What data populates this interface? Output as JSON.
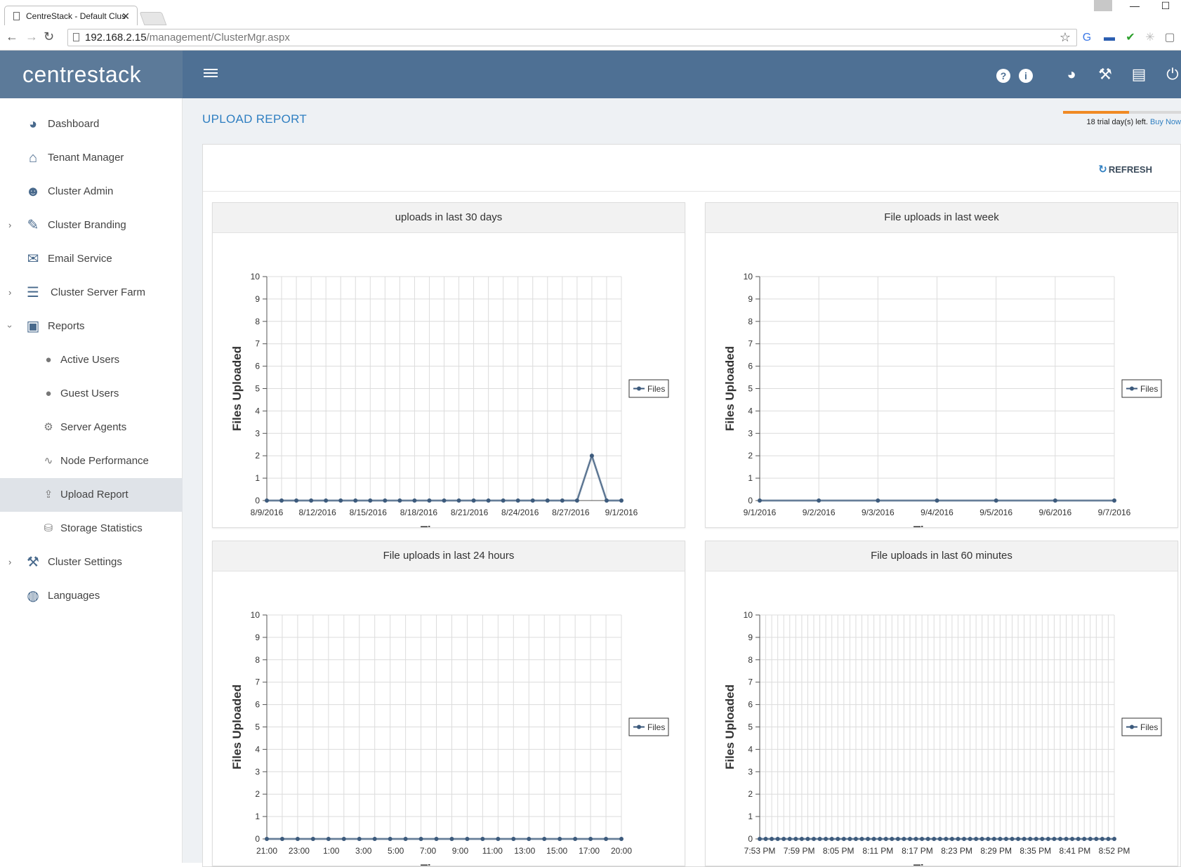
{
  "browser": {
    "tab_title": "CentreStack - Default Clus",
    "url_host": "192.168.2.15",
    "url_path": "/management/ClusterMgr.aspx"
  },
  "brand": {
    "name": "centrestack"
  },
  "colors": {
    "header": "#4e7094",
    "brand_bg": "#5c7a99",
    "accent": "#2f7fc1",
    "trial_bar": "#f08a24",
    "series": "#3c5a7c"
  },
  "sidebar": {
    "items": [
      {
        "label": "Dashboard",
        "icon": "dashboard-icon"
      },
      {
        "label": "Tenant Manager",
        "icon": "tenant-icon"
      },
      {
        "label": "Cluster Admin",
        "icon": "admin-icon"
      },
      {
        "label": "Cluster Branding",
        "icon": "branding-icon",
        "expandable": true
      },
      {
        "label": "Email Service",
        "icon": "email-icon"
      },
      {
        "label": "Cluster Server Farm",
        "icon": "server-farm-icon",
        "expandable": true
      },
      {
        "label": "Reports",
        "icon": "reports-icon",
        "expanded": true
      },
      {
        "label": "Active Users",
        "icon": "user-icon",
        "sub": true
      },
      {
        "label": "Guest Users",
        "icon": "guest-icon",
        "sub": true
      },
      {
        "label": "Server Agents",
        "icon": "agent-icon",
        "sub": true
      },
      {
        "label": "Node Performance",
        "icon": "performance-icon",
        "sub": true
      },
      {
        "label": "Upload Report",
        "icon": "upload-icon",
        "sub": true,
        "active": true
      },
      {
        "label": "Storage Statistics",
        "icon": "storage-icon",
        "sub": true
      },
      {
        "label": "Cluster Settings",
        "icon": "settings-icon",
        "expandable": true
      },
      {
        "label": "Languages",
        "icon": "globe-icon"
      }
    ]
  },
  "main": {
    "title": "UPLOAD REPORT",
    "trial_text": "18 trial day(s) left.",
    "trial_link": "Buy Now",
    "trial_progress": 0.56,
    "refresh_label": "REFRESH"
  },
  "chart_data": [
    {
      "type": "line",
      "title": "uploads in last 30 days",
      "xlabel": "Time",
      "ylabel": "Files Uploaded",
      "ylim": [
        0,
        10
      ],
      "grid": true,
      "legend": "right",
      "x_tick_labels": [
        "8/9/2016",
        "8/12/2016",
        "8/15/2016",
        "8/18/2016",
        "8/21/2016",
        "8/24/2016",
        "8/27/2016",
        "9/1/2016"
      ],
      "series": [
        {
          "name": "Files",
          "values": [
            0,
            0,
            0,
            0,
            0,
            0,
            0,
            0,
            0,
            0,
            0,
            0,
            0,
            0,
            0,
            0,
            0,
            0,
            0,
            0,
            0,
            0,
            2,
            0,
            0
          ]
        }
      ]
    },
    {
      "type": "line",
      "title": "File uploads in last week",
      "xlabel": "Time",
      "ylabel": "Files Uploaded",
      "ylim": [
        0,
        10
      ],
      "grid": true,
      "legend": "right",
      "x_tick_labels": [
        "9/1/2016",
        "9/2/2016",
        "9/3/2016",
        "9/4/2016",
        "9/5/2016",
        "9/6/2016",
        "9/7/2016"
      ],
      "series": [
        {
          "name": "Files",
          "values": [
            0,
            0,
            0,
            0,
            0,
            0,
            0
          ]
        }
      ]
    },
    {
      "type": "line",
      "title": "File uploads in last 24 hours",
      "xlabel": "Time",
      "ylabel": "Files Uploaded",
      "ylim": [
        0,
        10
      ],
      "grid": true,
      "legend": "right",
      "x_tick_labels": [
        "21:00",
        "23:00",
        "1:00",
        "3:00",
        "5:00",
        "7:00",
        "9:00",
        "11:00",
        "13:00",
        "15:00",
        "17:00",
        "20:00"
      ],
      "series": [
        {
          "name": "Files",
          "values": [
            0,
            0,
            0,
            0,
            0,
            0,
            0,
            0,
            0,
            0,
            0,
            0,
            0,
            0,
            0,
            0,
            0,
            0,
            0,
            0,
            0,
            0,
            0,
            0
          ]
        }
      ]
    },
    {
      "type": "line",
      "title": "File uploads in last 60 minutes",
      "xlabel": "Time",
      "ylabel": "Files Uploaded",
      "ylim": [
        0,
        10
      ],
      "grid": true,
      "legend": "right",
      "x_tick_labels": [
        "7:53 PM",
        "7:59 PM",
        "8:05 PM",
        "8:11 PM",
        "8:17 PM",
        "8:23 PM",
        "8:29 PM",
        "8:35 PM",
        "8:41 PM",
        "8:52 PM"
      ],
      "series": [
        {
          "name": "Files",
          "values": [
            0,
            0,
            0,
            0,
            0,
            0,
            0,
            0,
            0,
            0,
            0,
            0,
            0,
            0,
            0,
            0,
            0,
            0,
            0,
            0,
            0,
            0,
            0,
            0,
            0,
            0,
            0,
            0,
            0,
            0,
            0,
            0,
            0,
            0,
            0,
            0,
            0,
            0,
            0,
            0,
            0,
            0,
            0,
            0,
            0,
            0,
            0,
            0,
            0,
            0,
            0,
            0,
            0,
            0,
            0,
            0,
            0,
            0,
            0,
            0
          ]
        }
      ]
    }
  ]
}
